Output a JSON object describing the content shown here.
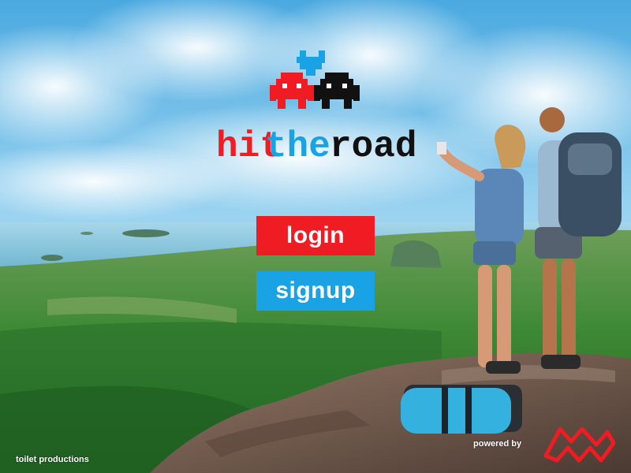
{
  "app": {
    "logo_words": [
      "hit",
      "the",
      "road"
    ]
  },
  "buttons": {
    "login_label": "login",
    "signup_label": "signup"
  },
  "footer": {
    "credit_left": "toilet productions",
    "credit_right": "powered by"
  },
  "colors": {
    "red": "#ef1c24",
    "blue": "#1aa3e4",
    "black": "#111111",
    "sky": "#8fcff0",
    "sea": "#7fc3df",
    "forest": "#2f7d2a",
    "rock": "#7a6357"
  },
  "icons": [
    "red-space-invader-icon",
    "black-space-invader-icon",
    "blue-heart-icon",
    "partner-logo-icon"
  ]
}
